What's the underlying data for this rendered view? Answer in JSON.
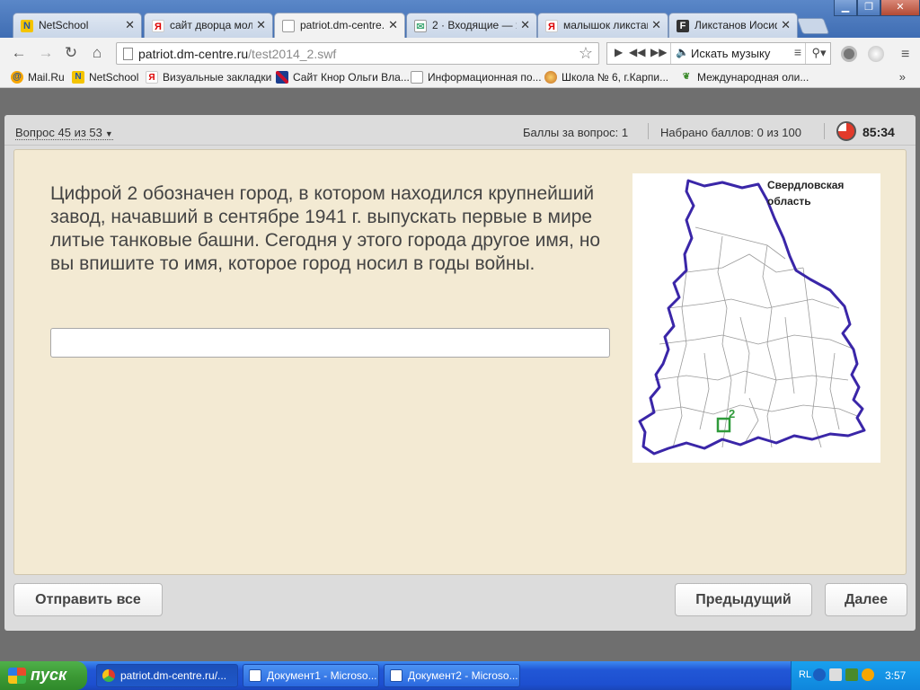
{
  "browser": {
    "tabs": [
      {
        "title": "NetSchool",
        "favicon": "netschool-icon"
      },
      {
        "title": "сайт дворца моло",
        "favicon": "yandex-icon"
      },
      {
        "title": "patriot.dm-centre.r",
        "favicon": "page-icon",
        "active": true
      },
      {
        "title": "2 · Входящие — Я",
        "favicon": "mail-icon"
      },
      {
        "title": "малышок ликстан",
        "favicon": "yandex-icon"
      },
      {
        "title": "Ликстанов Иосиф",
        "favicon": "fr-icon"
      }
    ],
    "url_host": "patriot.dm-centre.ru",
    "url_path": "/test2014_2.swf",
    "music_search_placeholder": "Искать музыку",
    "bookmarks": [
      {
        "label": "Mail.Ru",
        "icon": "mailru-icon"
      },
      {
        "label": "NetSchool",
        "icon": "netschool-icon"
      },
      {
        "label": "Визуальные закладки",
        "icon": "yandex-icon"
      },
      {
        "label": "Сайт Кнор Ольги Вла...",
        "icon": "uk-flag-icon"
      },
      {
        "label": "Информационная по...",
        "icon": "document-icon"
      },
      {
        "label": "Школа № 6, г.Карпи...",
        "icon": "school-icon"
      },
      {
        "label": "Международная оли...",
        "icon": "leaf-icon"
      }
    ],
    "bookmarks_more": "»",
    "colors": {
      "tabstrip": "#3f6db3",
      "accent_red": "#e23a2a"
    }
  },
  "test": {
    "question_counter": "Вопрос 45 из 53",
    "points_for_question": "Баллы за вопрос: 1",
    "points_total": "Набрано баллов: 0 из 100",
    "timer": "85:34",
    "question_text": "Цифрой 2 обозначен город, в котором находился крупнейший завод, начавший в сентябре 1941 г. выпускать первые в мире литые танковые башни. Сегодня у этого города другое имя, но вы впишите то имя, которое город носил в годы войны.",
    "answer_value": "",
    "map": {
      "title_line1": "Свердловская",
      "title_line2": "область",
      "marker_label": "2"
    },
    "buttons": {
      "submit_all": "Отправить все",
      "previous": "Предыдущий",
      "next": "Далее"
    }
  },
  "taskbar": {
    "start_label": "пуск",
    "tasks": [
      {
        "label": "patriot.dm-centre.ru/...",
        "icon": "chrome-icon",
        "active": true
      },
      {
        "label": "Документ1 - Microso...",
        "icon": "word-icon"
      },
      {
        "label": "Документ2 - Microso...",
        "icon": "word-icon"
      }
    ],
    "language": "RL",
    "clock": "3:57"
  }
}
